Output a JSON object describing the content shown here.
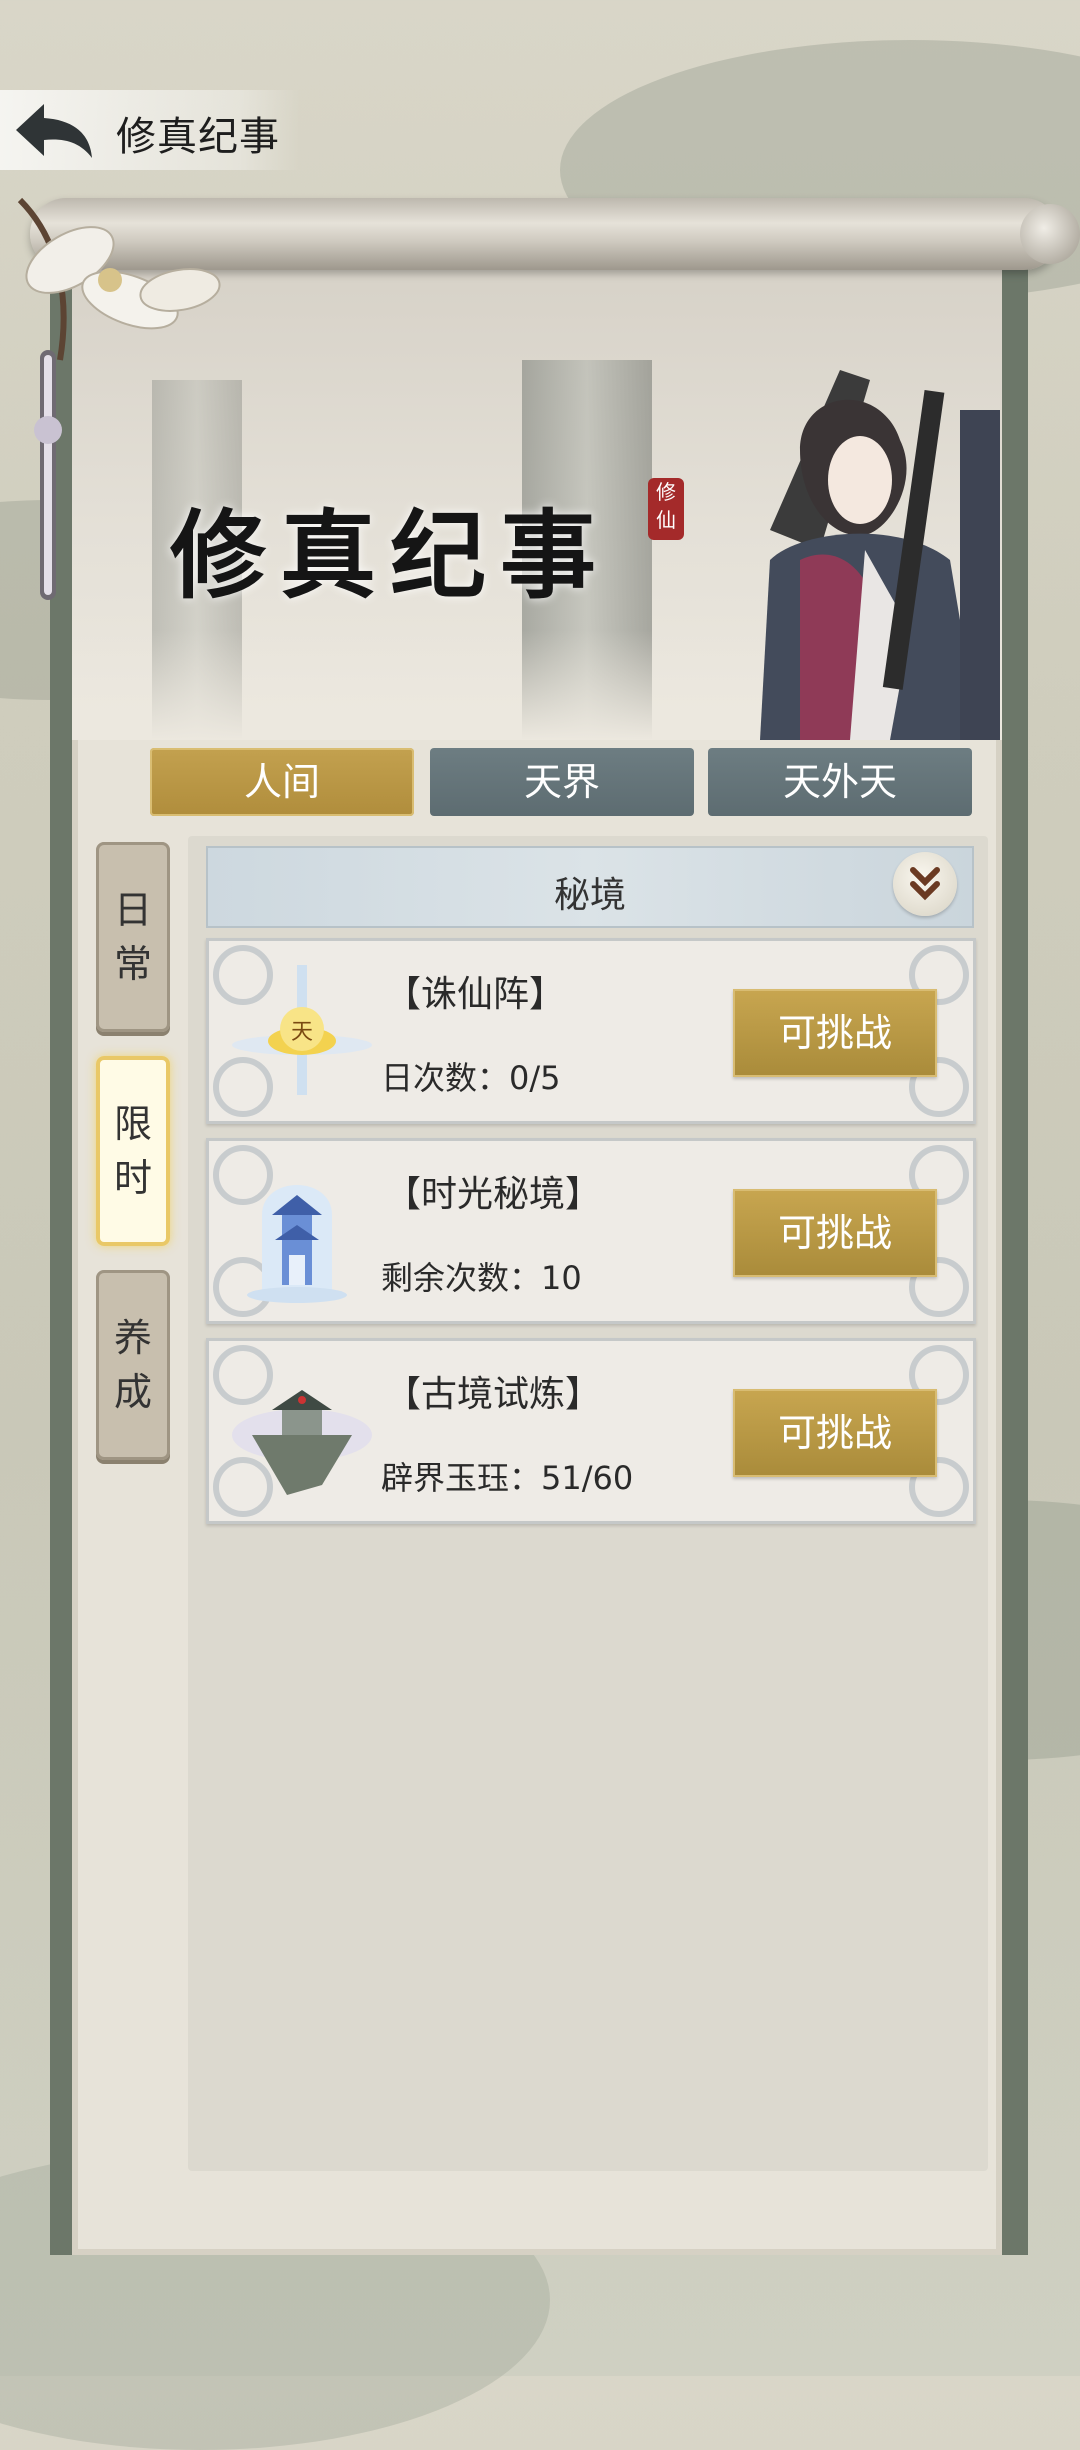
{
  "header": {
    "title": "修真纪事"
  },
  "banner": {
    "title": "修真纪事",
    "seal": "修仙"
  },
  "tabs": [
    {
      "label": "人间",
      "active": true
    },
    {
      "label": "天界",
      "active": false
    },
    {
      "label": "天外天",
      "active": false
    }
  ],
  "side_tabs": [
    {
      "chars": [
        "日",
        "常"
      ],
      "active": false
    },
    {
      "chars": [
        "限",
        "时"
      ],
      "active": true
    },
    {
      "chars": [
        "养",
        "成"
      ],
      "active": false
    }
  ],
  "section": {
    "label": "秘境"
  },
  "cards": [
    {
      "title": "【诛仙阵】",
      "info": "日次数：0/5",
      "button": "可挑战",
      "icon": "zhuxian-formation-icon",
      "icon_char": "天"
    },
    {
      "title": "【时光秘境】",
      "info": "剩余次数：10",
      "button": "可挑战",
      "icon": "time-realm-tower-icon"
    },
    {
      "title": "【古境试炼】",
      "info": "辟界玉珏：51/60",
      "button": "可挑战",
      "icon": "ancient-realm-island-icon"
    }
  ],
  "colors": {
    "gold_button": "#b6943f",
    "tab_inactive": "#66767b",
    "panel_bg": "#e7e3d9"
  }
}
